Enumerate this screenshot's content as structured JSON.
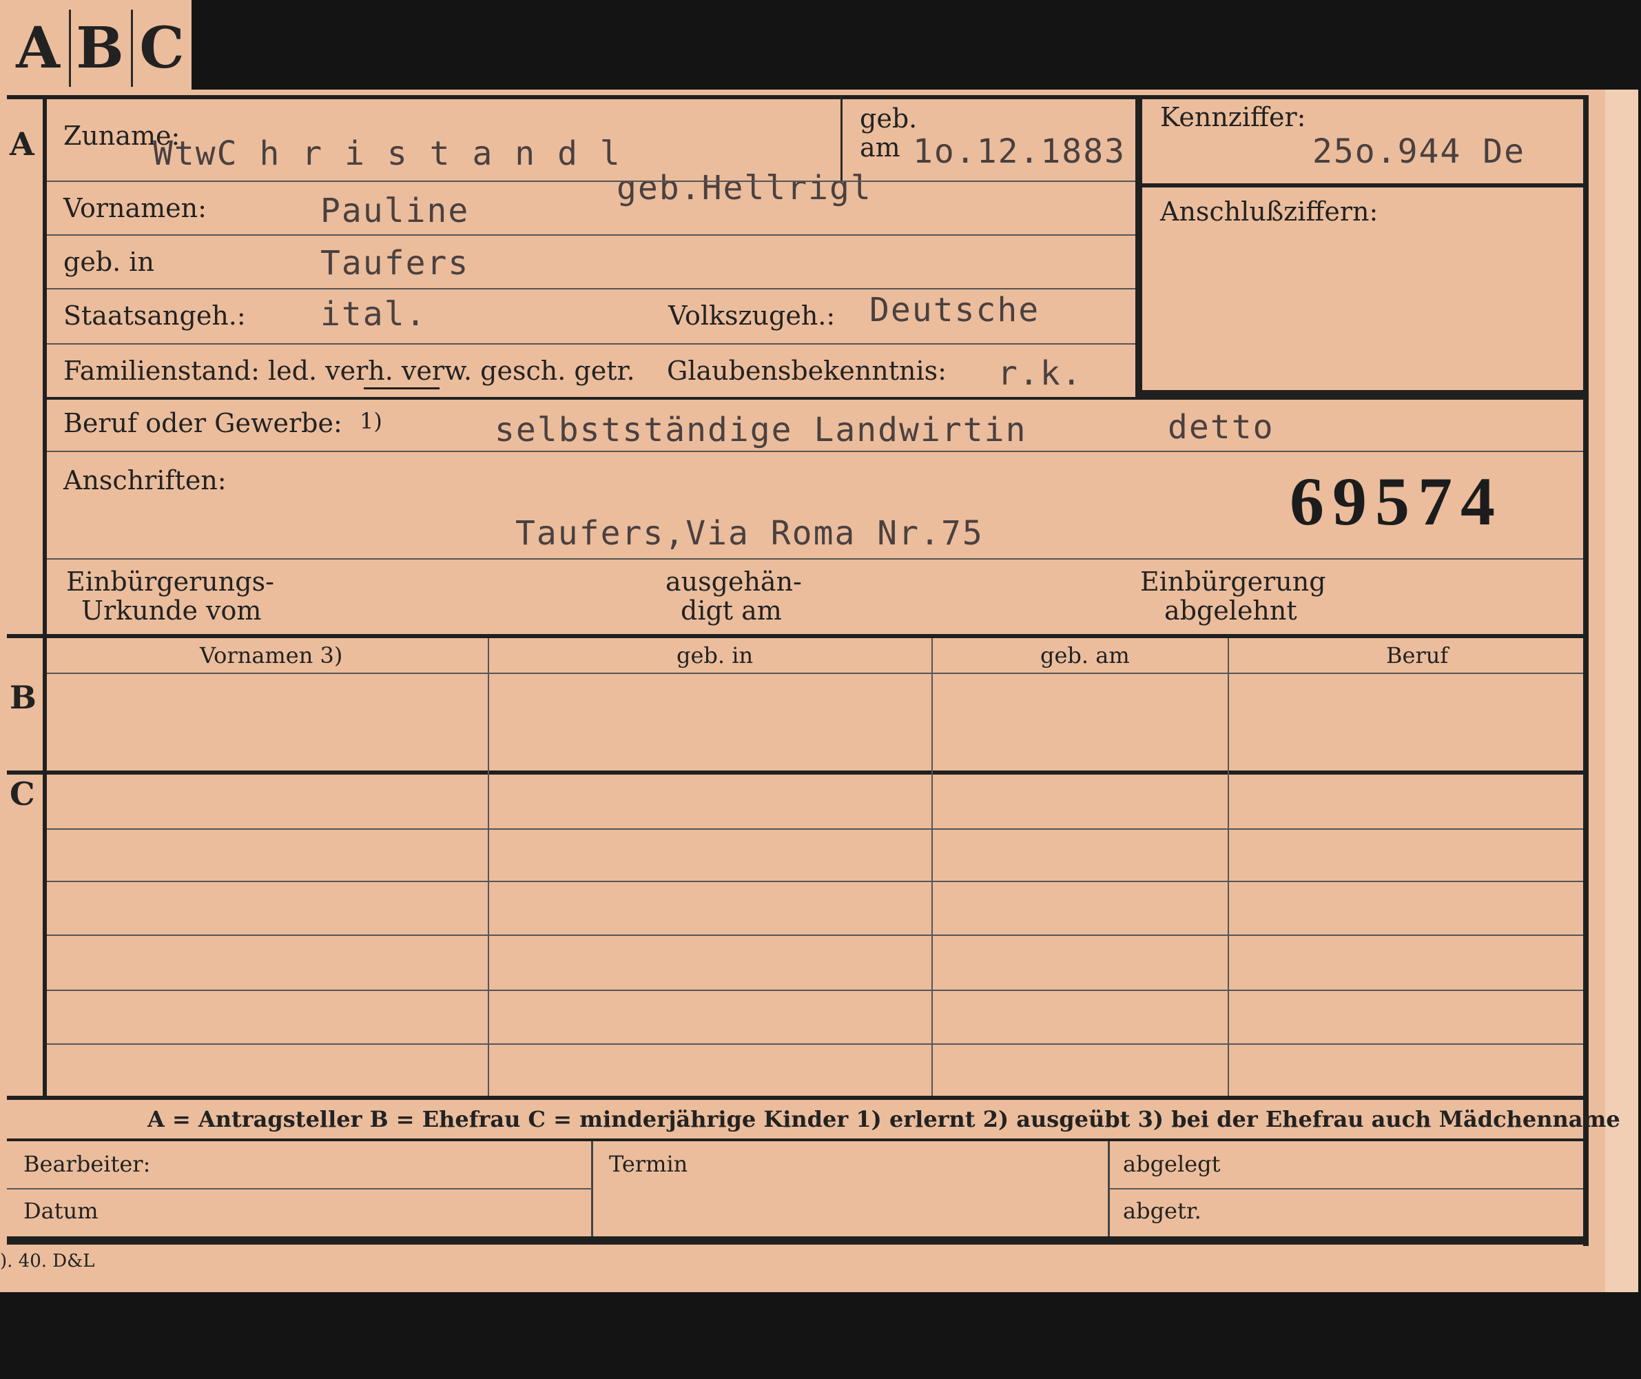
{
  "tabs": [
    "A",
    "B",
    "C"
  ],
  "rows": {
    "a": "A",
    "b": "B",
    "c": "C"
  },
  "section_a": {
    "surname_label": "Zuname:",
    "surname_value": "WtwC h r i s t a n d l",
    "maiden_value": "geb.Hellrigl",
    "born_label_top": "geb.",
    "born_label_bottom": "am",
    "born_date": "1o.12.1883",
    "kennziffer_label": "Kennziffer:",
    "kennziffer_value": "25o.944 De",
    "anschluss_label": "Anschlußziffern:",
    "vornamen_label": "Vornamen:",
    "vornamen_value": "Pauline",
    "geb_in_label": "geb. in",
    "geb_in_value": "Taufers",
    "staat_label": "Staatsangeh.:",
    "staat_value": "ital.",
    "volk_label": "Volkszugeh.:",
    "volk_value": "Deutsche",
    "familienstand_label": "Familienstand: led. verh. verw. gesch. getr.",
    "glaube_label": "Glaubensbekenntnis:",
    "glaube_value": "r.k.",
    "beruf_label": "Beruf oder Gewerbe:",
    "beruf_note": "1)",
    "beruf_value": "selbstständige Landwirtin",
    "beruf_value2": "detto",
    "anschriften_label": "Anschriften:",
    "anschriften_value": "Taufers,Via Roma Nr.75",
    "stamp_number": "69574",
    "einb_label_1": "Einbürgerungs-",
    "einb_label_2": "Urkunde vom",
    "ausgeh_label_1": "ausgehän-",
    "ausgeh_label_2": "digt am",
    "abgelehnt_label_1": "Einbürgerung",
    "abgelehnt_label_2": "abgelehnt"
  },
  "table_headers": [
    "Vornamen 3)",
    "geb. in",
    "geb. am",
    "Beruf"
  ],
  "legend": "A = Antragsteller   B = Ehefrau   C = minderjährige Kinder   1) erlernt   2) ausgeübt   3) bei der Ehefrau auch Mädchenname",
  "footer": {
    "bearbeiter": "Bearbeiter:",
    "datum": "Datum",
    "termin": "Termin",
    "abgelegt": "abgelegt",
    "abgetr": "abgetr."
  },
  "print_code": "). 40. D&L"
}
